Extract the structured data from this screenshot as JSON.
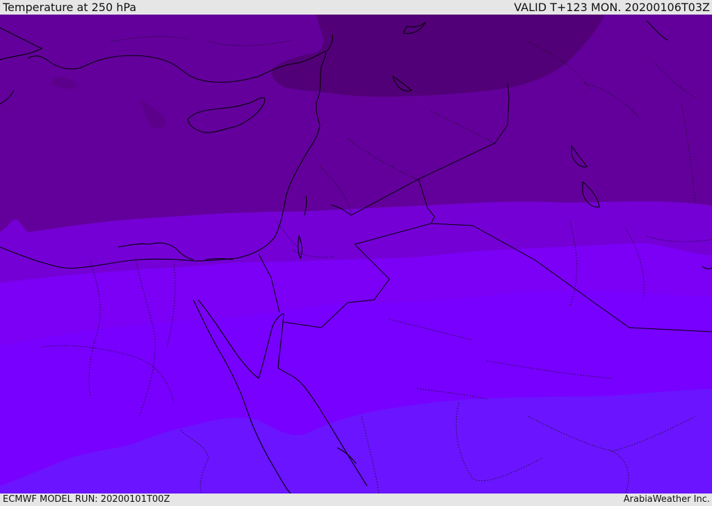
{
  "header": {
    "title": "Temperature at 250 hPa",
    "valid": "VALID T+123 MON. 20200106T03Z"
  },
  "footer": {
    "model_run": "ECMWF MODEL RUN: 20200101T00Z",
    "brand": "ArabiaWeather Inc."
  },
  "map": {
    "variable": "temperature",
    "level": "250 hPa",
    "band_colors": [
      "#520078",
      "#63009c",
      "#7113b8",
      "#7400d6",
      "#7b00f5",
      "#7800ff",
      "#6a14ff"
    ],
    "coastline_color": "#000000",
    "border_style": "dotted"
  }
}
